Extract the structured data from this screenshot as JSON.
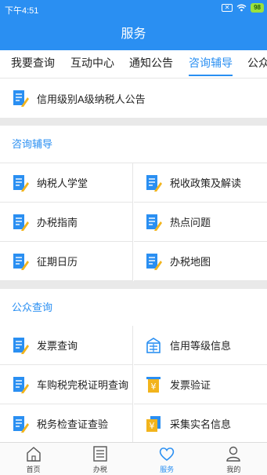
{
  "status_bar": {
    "time": "下午4:51",
    "battery": "98"
  },
  "header": {
    "title": "服务"
  },
  "tabs": [
    "我要查询",
    "互动中心",
    "通知公告",
    "咨询辅导",
    "公众查询"
  ],
  "notice": {
    "label": "信用级别A级纳税人公告",
    "icon": "document-pencil-icon"
  },
  "consult": {
    "title": "咨询辅导",
    "items": [
      {
        "label": "纳税人学堂",
        "icon": "document-pencil-icon"
      },
      {
        "label": "税收政策及解读",
        "icon": "document-pencil-icon"
      },
      {
        "label": "办税指南",
        "icon": "document-pencil-icon"
      },
      {
        "label": "热点问题",
        "icon": "document-pencil-icon"
      },
      {
        "label": "征期日历",
        "icon": "document-pencil-icon"
      },
      {
        "label": "办税地图",
        "icon": "document-pencil-icon"
      }
    ]
  },
  "public": {
    "title": "公众查询",
    "items": [
      {
        "label": "发票查询",
        "icon": "document-pencil-icon"
      },
      {
        "label": "信用等级信息",
        "icon": "credit-rating-icon"
      },
      {
        "label": "车购税完税证明查询",
        "icon": "document-pencil-icon"
      },
      {
        "label": "发票验证",
        "icon": "invoice-yen-icon"
      },
      {
        "label": "税务检查证查验",
        "icon": "document-pencil-icon"
      },
      {
        "label": "采集实名信息",
        "icon": "realname-yen-icon"
      }
    ]
  },
  "bottom_nav": [
    {
      "label": "首页",
      "icon": "home-icon"
    },
    {
      "label": "办税",
      "icon": "list-icon"
    },
    {
      "label": "服务",
      "icon": "heart-icon"
    },
    {
      "label": "我的",
      "icon": "user-icon"
    }
  ],
  "colors": {
    "primary": "#2a8ff2",
    "icon_yellow": "#f2b41c",
    "divider": "#e9e9e9"
  }
}
